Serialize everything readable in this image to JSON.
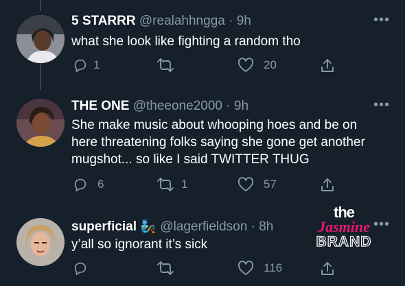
{
  "tweets": [
    {
      "name": "5 STARRR",
      "handle": "@realahhngga",
      "time": "9h",
      "text": "what she look like fighting a random tho",
      "replies": "1",
      "retweets": "",
      "likes": "20"
    },
    {
      "name": "THE ONE",
      "handle": "@theeone2000",
      "time": "9h",
      "text": "She make music about whooping hoes and be on here threatening folks saying she gone get another mugshot... so like I said TWITTER THUG",
      "replies": "6",
      "retweets": "1",
      "likes": "57"
    },
    {
      "name": "superficial",
      "handle": "@lagerfieldson",
      "time": "8h",
      "text": "y’all so ignorant it’s sick",
      "replies": "",
      "retweets": "",
      "likes": "116"
    }
  ],
  "separator": "·",
  "more_glyph": "•••",
  "name_emoji": "🧞",
  "watermark": {
    "line1": "the",
    "line2": "Jasmine",
    "line3": "BRAND"
  },
  "colors": {
    "background": "#15202b",
    "muted": "#8899a6",
    "text": "#ffffff",
    "watermark_pink": "#e8176f"
  }
}
